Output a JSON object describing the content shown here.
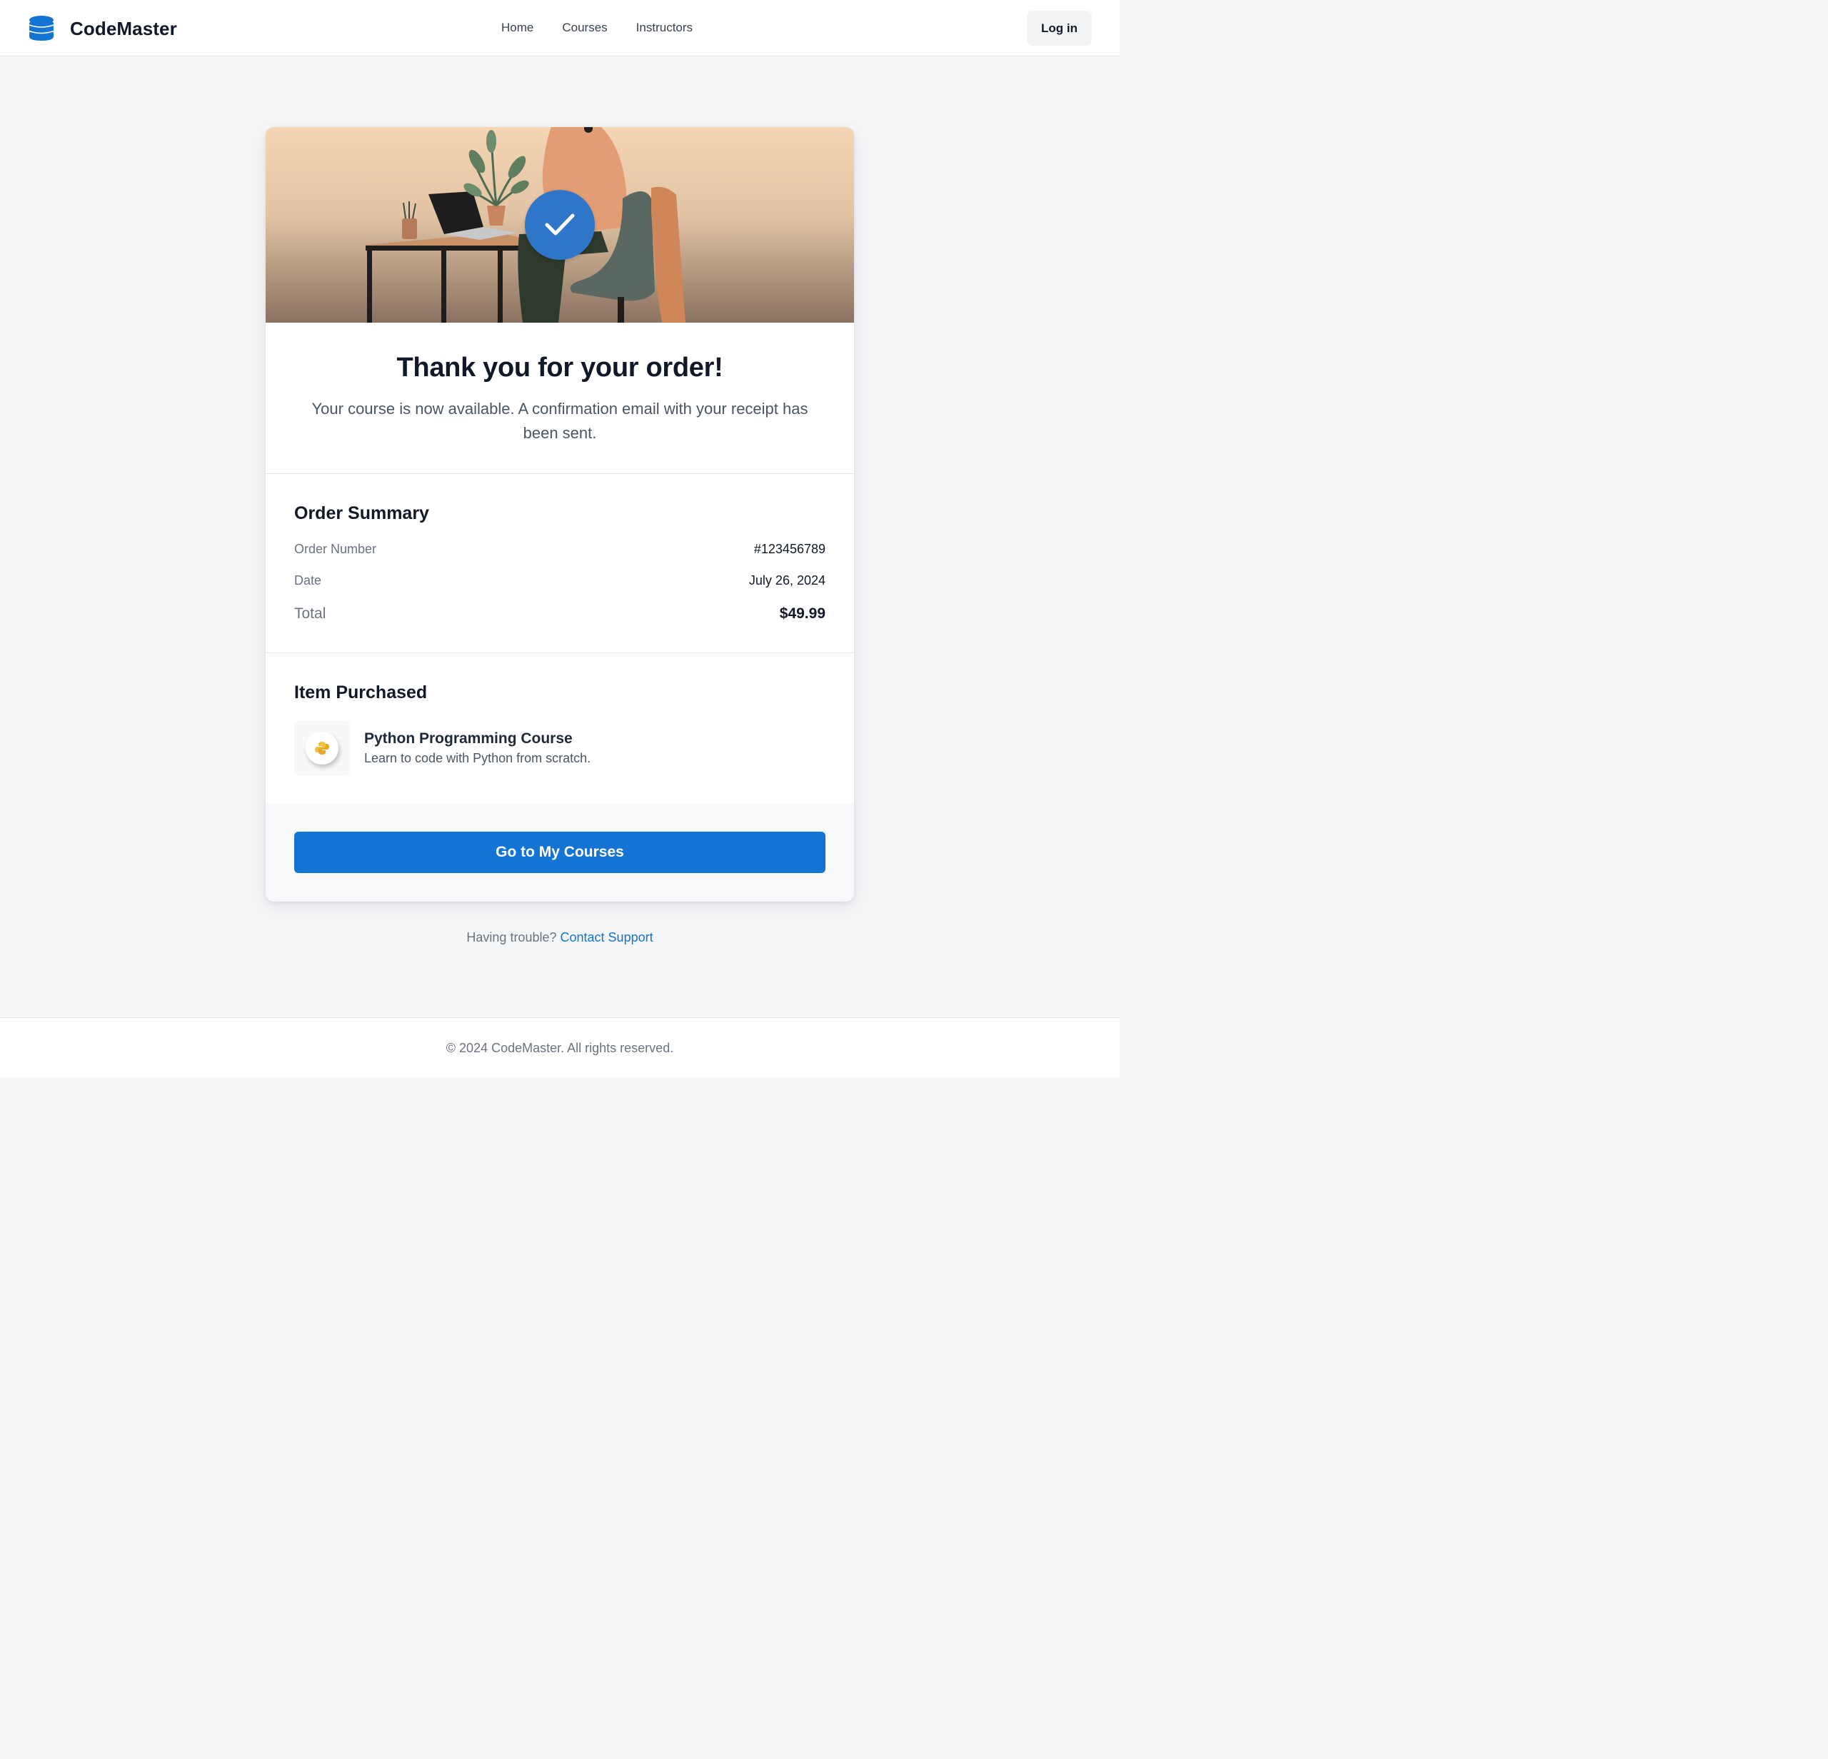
{
  "header": {
    "brand": "CodeMaster",
    "nav": [
      {
        "label": "Home"
      },
      {
        "label": "Courses"
      },
      {
        "label": "Instructors"
      }
    ],
    "login_label": "Log in"
  },
  "confirmation": {
    "title": "Thank you for your order!",
    "message": "Your course is now available. A confirmation email with your receipt has been sent."
  },
  "order_summary": {
    "title": "Order Summary",
    "order_number_label": "Order Number",
    "order_number": "#123456789",
    "date_label": "Date",
    "date": "July 26, 2024",
    "total_label": "Total",
    "total": "$49.99"
  },
  "item": {
    "section_title": "Item Purchased",
    "name": "Python Programming Course",
    "description": "Learn to code with Python from scratch."
  },
  "cta_label": "Go to My Courses",
  "support": {
    "prompt": "Having trouble?",
    "link_label": "Contact Support"
  },
  "footer": {
    "copyright": "© 2024 CodeMaster. All rights reserved."
  },
  "colors": {
    "accent": "#1474d4",
    "check_badge": "#2f76c9",
    "page_background": "#f4f6f8"
  },
  "icons": [
    "database-logo-icon",
    "checkmark-icon",
    "python-logo-icon"
  ]
}
